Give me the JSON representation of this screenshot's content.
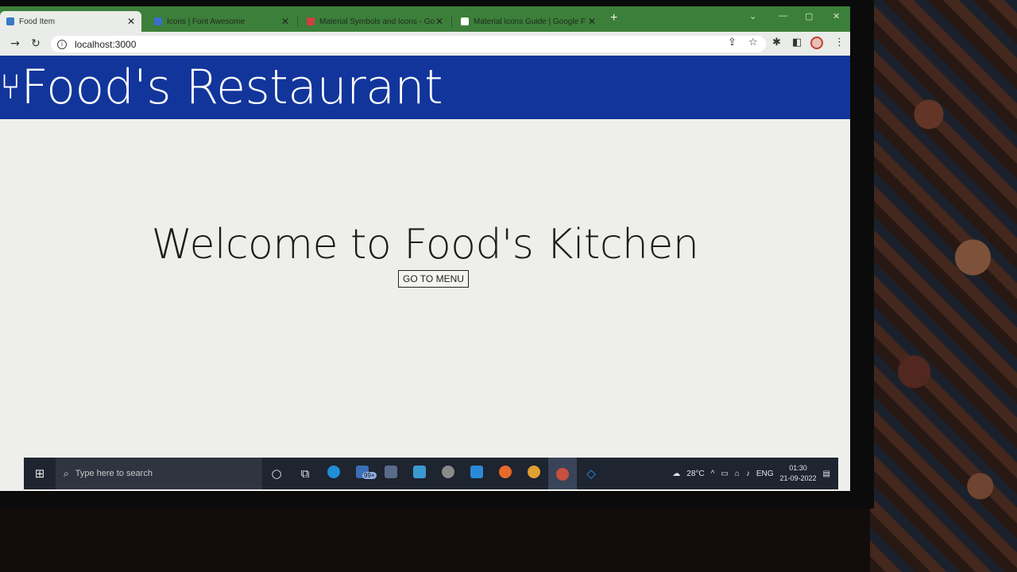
{
  "browser": {
    "tabs": [
      {
        "title": "Food Item",
        "active": true,
        "favicon_color": "#3a78c8"
      },
      {
        "title": "Icons | Font Awesome",
        "active": false,
        "favicon_color": "#3a6fd0"
      },
      {
        "title": "Material Symbols and Icons - Go",
        "active": false,
        "favicon_color": "#d04040"
      },
      {
        "title": "Material Icons Guide | Google F",
        "active": false,
        "favicon_color": "#ffffff"
      }
    ],
    "new_tab_label": "+",
    "url": "localhost:3000"
  },
  "header": {
    "icon": "fork-knife-icon",
    "brand": "Food's Restaurant",
    "color": "#12359b"
  },
  "hero": {
    "title": "Welcome to Food's Kitchen",
    "button_label": "GO TO MENU"
  },
  "taskbar": {
    "search_placeholder": "Type here to search",
    "mail_badge": "99+",
    "weather": "28°C",
    "language": "ENG",
    "time": "01:30",
    "date": "21-09-2022"
  }
}
